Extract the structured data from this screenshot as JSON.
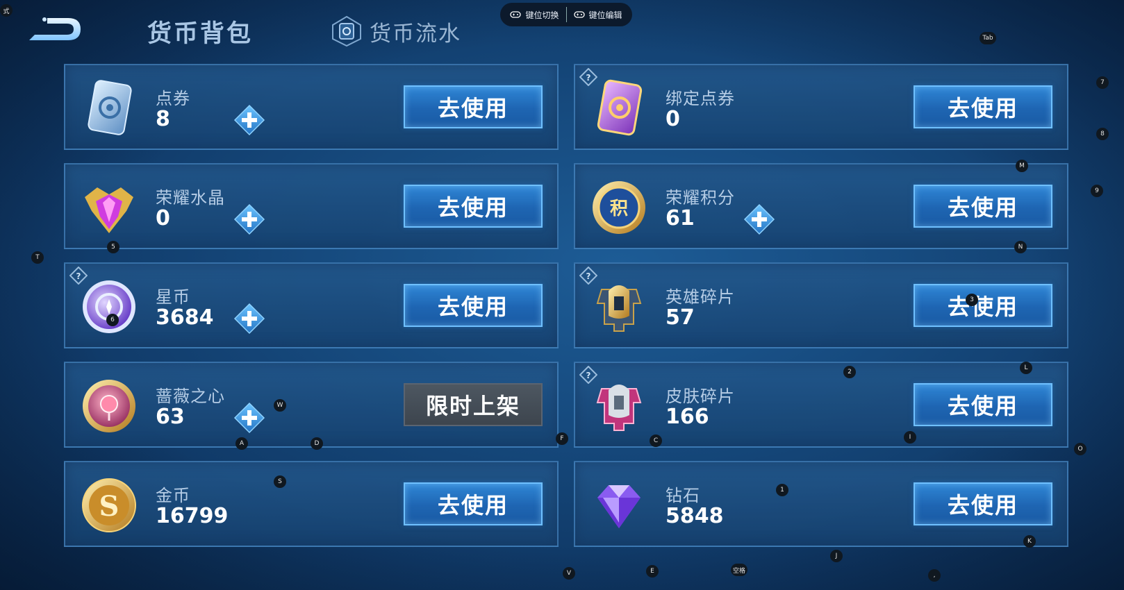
{
  "header": {
    "back_icon": "back-arrow-icon",
    "tab_bag": "货币背包",
    "tab_flow": "货币流水",
    "key_switch": "键位切换",
    "key_edit": "键位编辑"
  },
  "buttons": {
    "use": "去使用",
    "limited": "限时上架"
  },
  "currencies": [
    {
      "name": "点券",
      "value": "8",
      "icon": "voucher-card-icon",
      "has_plus": true,
      "has_help": false,
      "button": "去使用",
      "enabled": true
    },
    {
      "name": "绑定点券",
      "value": "0",
      "icon": "bound-voucher-card-icon",
      "has_plus": false,
      "has_help": true,
      "button": "去使用",
      "enabled": true
    },
    {
      "name": "荣耀水晶",
      "value": "0",
      "icon": "glory-crystal-icon",
      "has_plus": true,
      "has_help": false,
      "button": "去使用",
      "enabled": true
    },
    {
      "name": "荣耀积分",
      "value": "61",
      "icon": "glory-points-icon",
      "has_plus": true,
      "has_help": false,
      "button": "去使用",
      "enabled": true
    },
    {
      "name": "星币",
      "value": "3684",
      "icon": "star-coin-icon",
      "has_plus": true,
      "has_help": true,
      "button": "去使用",
      "enabled": true
    },
    {
      "name": "英雄碎片",
      "value": "57",
      "icon": "hero-fragment-icon",
      "has_plus": false,
      "has_help": true,
      "button": "去使用",
      "enabled": true
    },
    {
      "name": "蔷薇之心",
      "value": "63",
      "icon": "rose-heart-icon",
      "has_plus": true,
      "has_help": false,
      "button": "限时上架",
      "enabled": false
    },
    {
      "name": "皮肤碎片",
      "value": "166",
      "icon": "skin-fragment-icon",
      "has_plus": false,
      "has_help": true,
      "button": "去使用",
      "enabled": true
    },
    {
      "name": "金币",
      "value": "16799",
      "icon": "gold-coin-icon",
      "has_plus": false,
      "has_help": false,
      "button": "去使用",
      "enabled": true
    },
    {
      "name": "钻石",
      "value": "5848",
      "icon": "diamond-icon",
      "has_plus": false,
      "has_help": false,
      "button": "去使用",
      "enabled": true
    }
  ],
  "key_hints": [
    "式",
    "Tab",
    "7",
    "8",
    "M",
    "9",
    "T",
    "5",
    "N",
    "6",
    "3",
    "2",
    "L",
    "W",
    "A",
    "D",
    "F",
    "C",
    "I",
    "O",
    "S",
    "1",
    "K",
    "J",
    "V",
    "E",
    "空格",
    ","
  ],
  "colors": {
    "background": "#164a7e",
    "button": "#1e65b2",
    "button_border": "#6fc0ff",
    "disabled_button": "#3d454e"
  }
}
